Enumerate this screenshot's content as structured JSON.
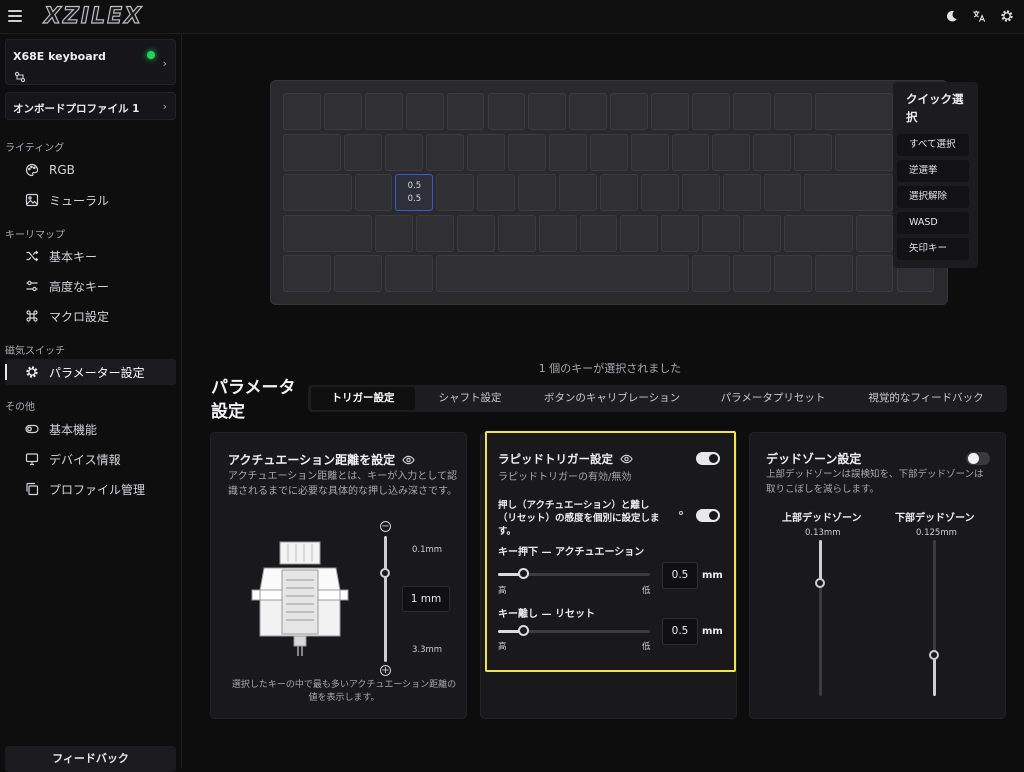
{
  "app": {
    "logo": "XZILEX"
  },
  "sidebar": {
    "device_name": "X68E keyboard",
    "profile": "オンボードプロファイル 1",
    "sections": {
      "lighting": "ライティング",
      "keymap": "キーリマップ",
      "magnetic": "磁気スイッチ",
      "other": "その他"
    },
    "items": {
      "rgb": "RGB",
      "mural": "ミューラル",
      "basic_key": "基本キー",
      "advanced_key": "高度なキー",
      "macro": "マクロ設定",
      "parameter": "パラメーター設定",
      "basic_function": "基本機能",
      "device_info": "デバイス情報",
      "profile_mgmt": "プロファイル管理"
    },
    "feedback": "フィードバック"
  },
  "keyboard": {
    "selected_key_top": "0.5",
    "selected_key_bottom": "0.5"
  },
  "quick_select": {
    "title": "クイック選択",
    "buttons": [
      "すべて選択",
      "逆選挙",
      "選択解除",
      "WASD",
      "矢印キー"
    ]
  },
  "selected_count": "1 個のキーが選択されました",
  "params": {
    "title": "パラメータ設定",
    "tabs": [
      "トリガー設定",
      "シャフト設定",
      "ボタンのキャリブレーション",
      "パラメータプリセット",
      "視覚的なフィードバック"
    ],
    "active_tab": 0
  },
  "actuation": {
    "title": "アクチュエーション距離を設定",
    "desc": "アクチュエーション距離とは、キーが入力として認識されるまでに必要な具体的な押し込み深さです。",
    "min": "0.1mm",
    "max": "3.3mm",
    "value": "1 mm",
    "footnote": "選択したキーの中で最も多いアクチュエーション距離の値を表示します。"
  },
  "rapid_trigger": {
    "title": "ラピッドトリガー設定",
    "desc": "ラピッドトリガーの有効/無効",
    "separate_label": "押し（アクチュエーション）と離し（リセット）の感度を個別に設定します。",
    "press_label": "キー押下 — アクチュエーション",
    "press_value": "0.5",
    "release_label": "キー離し — リセット",
    "release_value": "0.5",
    "unit": "mm",
    "high": "高",
    "low": "低",
    "enabled": true,
    "separate_enabled": true
  },
  "deadzone": {
    "title": "デッドゾーン設定",
    "desc": "上部デッドゾーンは誤検知を、下部デッドゾーンは取りこぼしを減らします。",
    "top_label": "上部デッドゾーン",
    "top_value": "0.13mm",
    "bottom_label": "下部デッドゾーン",
    "bottom_value": "0.125mm",
    "enabled": false
  },
  "colors": {
    "accent_highlight": "#f1e34a",
    "status_online": "#21d15a",
    "selected_key_border": "#3a5ad8"
  }
}
